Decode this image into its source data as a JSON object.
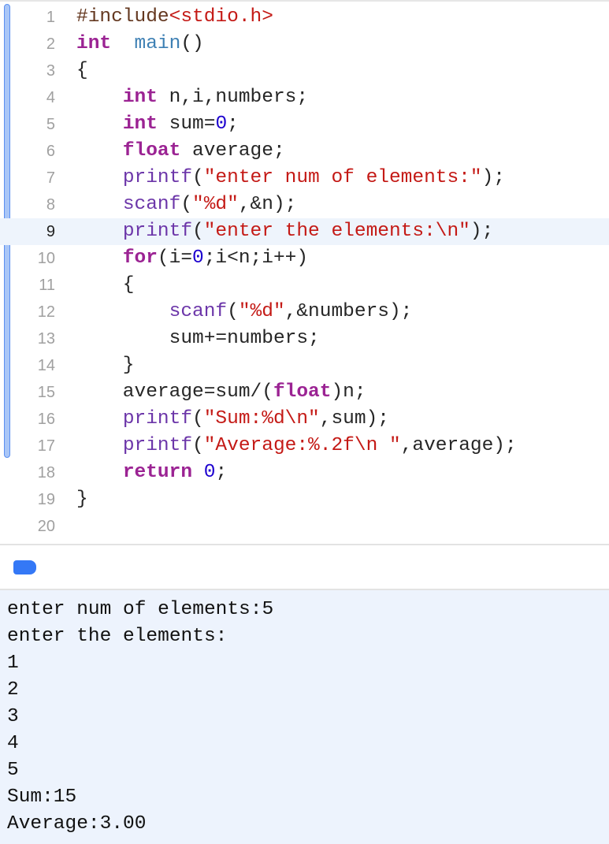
{
  "editor": {
    "active_line": 9,
    "lines": [
      [
        [
          "pp",
          "#include"
        ],
        [
          "str",
          "<stdio.h>"
        ]
      ],
      [
        [
          "kw",
          "int"
        ],
        [
          "",
          "  "
        ],
        [
          "decl",
          "main"
        ],
        [
          "",
          "()"
        ]
      ],
      [
        [
          "",
          "{"
        ]
      ],
      [
        [
          "",
          "    "
        ],
        [
          "kw",
          "int"
        ],
        [
          "",
          " n,i,numbers;"
        ]
      ],
      [
        [
          "",
          "    "
        ],
        [
          "kw",
          "int"
        ],
        [
          "",
          " sum="
        ],
        [
          "num",
          "0"
        ],
        [
          "",
          ";"
        ]
      ],
      [
        [
          "",
          "    "
        ],
        [
          "kw",
          "float"
        ],
        [
          "",
          " average;"
        ]
      ],
      [
        [
          "",
          "    "
        ],
        [
          "fn",
          "printf"
        ],
        [
          "",
          "("
        ],
        [
          "str",
          "\"enter num of elements:\""
        ],
        [
          "",
          ");"
        ]
      ],
      [
        [
          "",
          "    "
        ],
        [
          "fn",
          "scanf"
        ],
        [
          "",
          "("
        ],
        [
          "str",
          "\"%d\""
        ],
        [
          "",
          ",&n);"
        ]
      ],
      [
        [
          "",
          "    "
        ],
        [
          "fn",
          "printf"
        ],
        [
          "",
          "("
        ],
        [
          "str",
          "\"enter the elements:\\n\""
        ],
        [
          "",
          ");"
        ]
      ],
      [
        [
          "",
          "    "
        ],
        [
          "kw",
          "for"
        ],
        [
          "",
          "(i="
        ],
        [
          "num",
          "0"
        ],
        [
          "",
          ";i<n;i++)"
        ]
      ],
      [
        [
          "",
          "    {"
        ]
      ],
      [
        [
          "",
          "        "
        ],
        [
          "fn",
          "scanf"
        ],
        [
          "",
          "("
        ],
        [
          "str",
          "\"%d\""
        ],
        [
          "",
          ",&numbers);"
        ]
      ],
      [
        [
          "",
          "        sum+=numbers;"
        ]
      ],
      [
        [
          "",
          "    }"
        ]
      ],
      [
        [
          "",
          "    average=sum/("
        ],
        [
          "kw",
          "float"
        ],
        [
          "",
          ")n;"
        ]
      ],
      [
        [
          "",
          "    "
        ],
        [
          "fn",
          "printf"
        ],
        [
          "",
          "("
        ],
        [
          "str",
          "\"Sum:%d\\n\""
        ],
        [
          "",
          ",sum);"
        ]
      ],
      [
        [
          "",
          "    "
        ],
        [
          "fn",
          "printf"
        ],
        [
          "",
          "("
        ],
        [
          "str",
          "\"Average:%.2f\\n \""
        ],
        [
          "",
          ",average);"
        ]
      ],
      [
        [
          "",
          "    "
        ],
        [
          "kw",
          "return"
        ],
        [
          "",
          " "
        ],
        [
          "num",
          "0"
        ],
        [
          "",
          ";"
        ]
      ],
      [
        [
          "",
          "}"
        ]
      ],
      [
        [
          "",
          ""
        ]
      ]
    ]
  },
  "console": {
    "lines": [
      "enter num of elements:5",
      "enter the elements:",
      "1",
      "2",
      "3",
      "4",
      "5",
      "Sum:15",
      "Average:3.00"
    ]
  }
}
